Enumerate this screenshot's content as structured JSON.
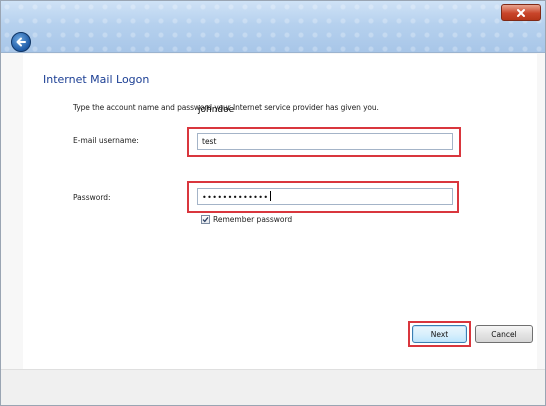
{
  "window": {
    "close_icon": "close-icon",
    "back_icon": "back-arrow-icon"
  },
  "page": {
    "title": "Internet Mail Logon",
    "instructions": "Type the account name and password your Internet service provider has given you.",
    "overlay_text": "johndoe"
  },
  "form": {
    "email_label": "E-mail username:",
    "email_value": "test",
    "password_label": "Password:",
    "password_value": "•••••••••••••",
    "remember_label": "Remember password",
    "remember_checked": true
  },
  "buttons": {
    "next": "Next",
    "cancel": "Cancel"
  },
  "colors": {
    "highlight": "#d9363d",
    "title": "#1c3f94"
  }
}
